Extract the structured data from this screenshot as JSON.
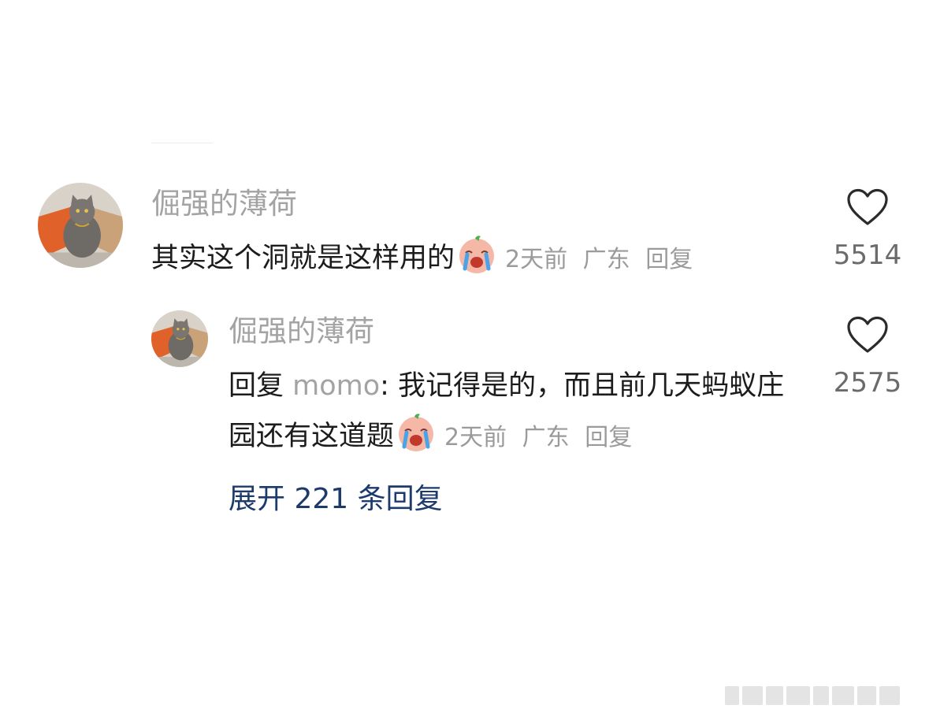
{
  "comment": {
    "username": "倔强的薄荷",
    "text": "其实这个洞就是这样用的",
    "emoji": "crying-face-emoji",
    "time": "2天前",
    "location": "广东",
    "reply_label": "回复",
    "like_count": "5514"
  },
  "reply": {
    "username": "倔强的薄荷",
    "prefix": "回复",
    "mention": "momo",
    "separator": ": ",
    "text": "我记得是的，而且前几天蚂蚁庄园还有这道题",
    "emoji": "crying-face-emoji",
    "time": "2天前",
    "location": "广东",
    "reply_label": "回复",
    "like_count": "2575"
  },
  "expand_replies": "展开 221 条回复",
  "icons": {
    "like": "heart-outline-icon",
    "avatar": "cat-avatar"
  },
  "colors": {
    "username": "#a3a3a3",
    "meta": "#9b9b9b",
    "link": "#1c3a6c",
    "text": "#1c1c1c"
  }
}
